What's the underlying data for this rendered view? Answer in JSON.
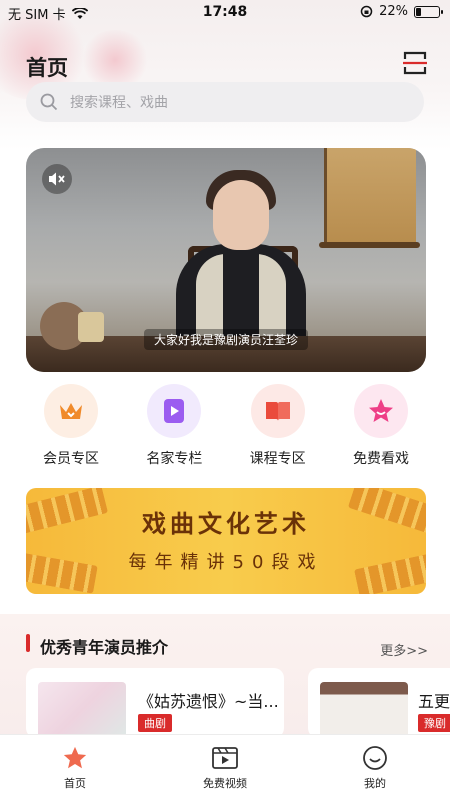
{
  "status_bar": {
    "carrier": "无 SIM 卡",
    "time": "17:48",
    "battery": "22%",
    "battery_level": 0.22
  },
  "header": {
    "title": "首页",
    "scan_icon": "scan-icon"
  },
  "search": {
    "placeholder": "搜索课程、戏曲"
  },
  "video": {
    "subtitle": "大家好我是豫剧演员汪荃珍",
    "mute_icon": "volume-mute-icon"
  },
  "categories": [
    {
      "label": "会员专区",
      "icon": "crown-icon",
      "color": "#f08a2a",
      "bg": "#fdeee3"
    },
    {
      "label": "名家专栏",
      "icon": "play-icon",
      "color": "#9b5cf0",
      "bg": "#f1eafd"
    },
    {
      "label": "课程专区",
      "icon": "book-icon",
      "color": "#ea4b3c",
      "bg": "#fde9e6"
    },
    {
      "label": "免费看戏",
      "icon": "star-icon",
      "color": "#ee3f87",
      "bg": "#fde7f0"
    }
  ],
  "banner": {
    "title": "戏曲文化艺术",
    "subtitle": "每年精讲50段戏"
  },
  "section": {
    "title": "优秀青年演员推介",
    "more": "更多>>",
    "cards": [
      {
        "title": "《姑苏遗恨》~当...",
        "tag": "曲剧"
      },
      {
        "title": "五更",
        "tag": "豫剧"
      }
    ]
  },
  "tabs": [
    {
      "label": "首页",
      "icon": "home-star-icon",
      "active": true
    },
    {
      "label": "免费视频",
      "icon": "video-icon",
      "active": false
    },
    {
      "label": "我的",
      "icon": "profile-smile-icon",
      "active": false
    }
  ],
  "colors": {
    "accent": "#d92b2b",
    "banner": "#f6b93a"
  }
}
